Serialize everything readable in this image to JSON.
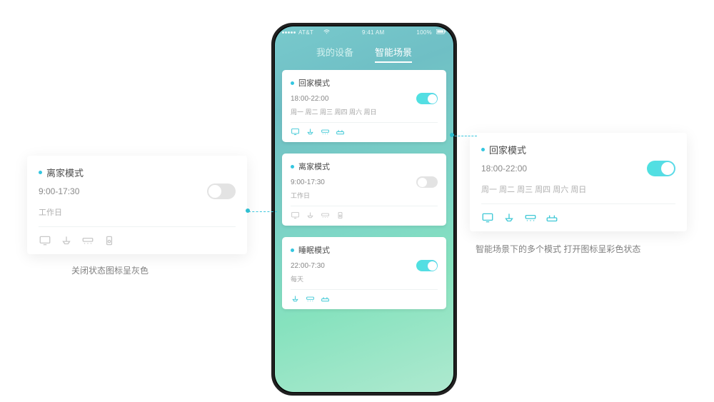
{
  "statusbar": {
    "carrier": "AT&T",
    "time": "9:41 AM",
    "battery": "100%"
  },
  "tabs": {
    "inactive": "我的设备",
    "active": "智能场景"
  },
  "scenes": [
    {
      "title": "回家模式",
      "time": "18:00-22:00",
      "days": "周一 周二 周三 周四 周六 周日",
      "toggle_on": true,
      "icons": [
        "monitor",
        "lamp",
        "ac",
        "router"
      ],
      "icon_color": true
    },
    {
      "title": "离家模式",
      "time": "9:00-17:30",
      "days": "工作日",
      "toggle_on": false,
      "icons": [
        "monitor",
        "lamp",
        "ac",
        "speaker"
      ],
      "icon_color": false
    },
    {
      "title": "睡眠模式",
      "time": "22:00-7:30",
      "days": "每天",
      "toggle_on": true,
      "icons": [
        "lamp",
        "ac",
        "router"
      ],
      "icon_color": true
    }
  ],
  "left_popout": {
    "title": "离家模式",
    "time": "9:00-17:30",
    "days": "工作日",
    "toggle_on": false,
    "icons": [
      "monitor",
      "lamp",
      "ac",
      "speaker"
    ],
    "icon_color": false
  },
  "right_popout": {
    "title": "回家模式",
    "time": "18:00-22:00",
    "days": "周一 周二 周三 周四 周六 周日",
    "toggle_on": true,
    "icons": [
      "monitor",
      "lamp",
      "ac",
      "router"
    ],
    "icon_color": true
  },
  "caption_left": "关闭状态图标呈灰色",
  "caption_right": "智能场景下的多个模式 打开图标呈彩色状态"
}
